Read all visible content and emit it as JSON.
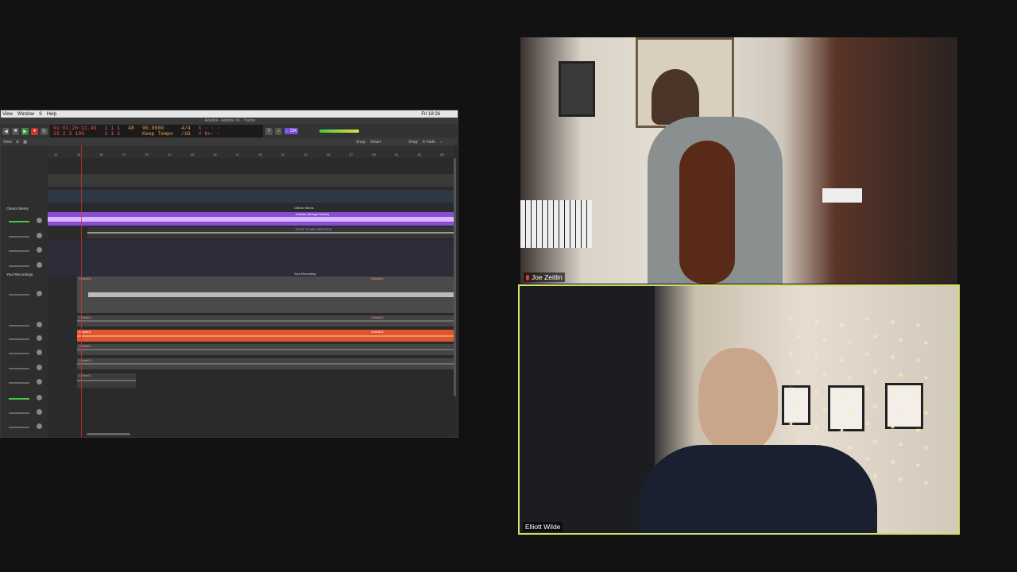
{
  "daw": {
    "menu": [
      "View",
      "Window",
      "9",
      "Help"
    ],
    "menu_right": [
      "Fri 18:26"
    ],
    "title": "Adeline - Adeline #1 - Tracks",
    "lcd": {
      "time_top": "01:01:26:11.49",
      "time_bottom": "33  2  3  190",
      "pos_top": "1  1  1",
      "pos_bottom": "1  1  1",
      "bar": "48",
      "tempo": "90.0000",
      "tempo_label": "Keep Tempo",
      "sig_top": "4/4",
      "sig_bottom": "/16",
      "key_top": "X ◦ ◦ ◦",
      "key_bottom": "# ɓc◦ ◦"
    },
    "tempo_button": "♩234",
    "toolbar": {
      "view": "View",
      "snap_label": "Snap:",
      "snap_value": "Smart",
      "drag_label": "Drag:",
      "drag_value": "X-Fade"
    },
    "ruler_bars": [
      "31",
      "33",
      "35",
      "37",
      "39",
      "41",
      "43",
      "45",
      "47",
      "49",
      "51",
      "53",
      "55",
      "57",
      "59",
      "61",
      "63",
      "65"
    ],
    "tracks": [
      {
        "label": "Clients Stems"
      },
      {
        "label": "Your Recordings"
      }
    ],
    "regions": {
      "clients_stems_title": "Clients Stems",
      "adeline_strings": "Adeline (Strings Muted)",
      "adeline_second": "NOTE TO ME (ORCHES)",
      "your_recording_title": "Your Recording",
      "cello_a": "Cello#01",
      "cello_b": "Cello#01",
      "cello_c": "Cello#01",
      "cello_d": "Cello#01",
      "cello_e": "Cello#01",
      "cello_f": "Cello#01",
      "cello_g": "Cello#01",
      "cello_h": "Cello#01",
      "cello_i": "Cello#01"
    }
  },
  "participants": [
    {
      "name": "Joe Zeitlin",
      "muted": true
    },
    {
      "name": "Elliott Wilde",
      "active_speaker": true
    }
  ],
  "colors": {
    "purple_region": "#8a4bd6",
    "orange_region": "#e0562c",
    "active_speaker_border": "#cfe06a"
  }
}
